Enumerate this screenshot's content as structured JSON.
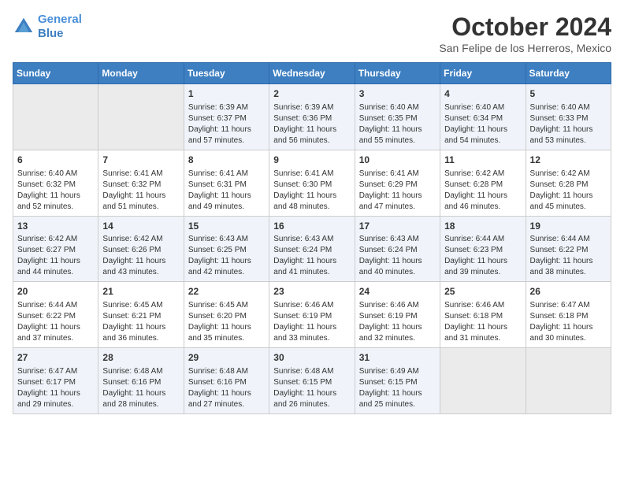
{
  "header": {
    "logo_line1": "General",
    "logo_line2": "Blue",
    "title": "October 2024",
    "subtitle": "San Felipe de los Herreros, Mexico"
  },
  "weekdays": [
    "Sunday",
    "Monday",
    "Tuesday",
    "Wednesday",
    "Thursday",
    "Friday",
    "Saturday"
  ],
  "weeks": [
    [
      {
        "day": "",
        "sunrise": "",
        "sunset": "",
        "daylight": ""
      },
      {
        "day": "",
        "sunrise": "",
        "sunset": "",
        "daylight": ""
      },
      {
        "day": "1",
        "sunrise": "Sunrise: 6:39 AM",
        "sunset": "Sunset: 6:37 PM",
        "daylight": "Daylight: 11 hours and 57 minutes."
      },
      {
        "day": "2",
        "sunrise": "Sunrise: 6:39 AM",
        "sunset": "Sunset: 6:36 PM",
        "daylight": "Daylight: 11 hours and 56 minutes."
      },
      {
        "day": "3",
        "sunrise": "Sunrise: 6:40 AM",
        "sunset": "Sunset: 6:35 PM",
        "daylight": "Daylight: 11 hours and 55 minutes."
      },
      {
        "day": "4",
        "sunrise": "Sunrise: 6:40 AM",
        "sunset": "Sunset: 6:34 PM",
        "daylight": "Daylight: 11 hours and 54 minutes."
      },
      {
        "day": "5",
        "sunrise": "Sunrise: 6:40 AM",
        "sunset": "Sunset: 6:33 PM",
        "daylight": "Daylight: 11 hours and 53 minutes."
      }
    ],
    [
      {
        "day": "6",
        "sunrise": "Sunrise: 6:40 AM",
        "sunset": "Sunset: 6:32 PM",
        "daylight": "Daylight: 11 hours and 52 minutes."
      },
      {
        "day": "7",
        "sunrise": "Sunrise: 6:41 AM",
        "sunset": "Sunset: 6:32 PM",
        "daylight": "Daylight: 11 hours and 51 minutes."
      },
      {
        "day": "8",
        "sunrise": "Sunrise: 6:41 AM",
        "sunset": "Sunset: 6:31 PM",
        "daylight": "Daylight: 11 hours and 49 minutes."
      },
      {
        "day": "9",
        "sunrise": "Sunrise: 6:41 AM",
        "sunset": "Sunset: 6:30 PM",
        "daylight": "Daylight: 11 hours and 48 minutes."
      },
      {
        "day": "10",
        "sunrise": "Sunrise: 6:41 AM",
        "sunset": "Sunset: 6:29 PM",
        "daylight": "Daylight: 11 hours and 47 minutes."
      },
      {
        "day": "11",
        "sunrise": "Sunrise: 6:42 AM",
        "sunset": "Sunset: 6:28 PM",
        "daylight": "Daylight: 11 hours and 46 minutes."
      },
      {
        "day": "12",
        "sunrise": "Sunrise: 6:42 AM",
        "sunset": "Sunset: 6:28 PM",
        "daylight": "Daylight: 11 hours and 45 minutes."
      }
    ],
    [
      {
        "day": "13",
        "sunrise": "Sunrise: 6:42 AM",
        "sunset": "Sunset: 6:27 PM",
        "daylight": "Daylight: 11 hours and 44 minutes."
      },
      {
        "day": "14",
        "sunrise": "Sunrise: 6:42 AM",
        "sunset": "Sunset: 6:26 PM",
        "daylight": "Daylight: 11 hours and 43 minutes."
      },
      {
        "day": "15",
        "sunrise": "Sunrise: 6:43 AM",
        "sunset": "Sunset: 6:25 PM",
        "daylight": "Daylight: 11 hours and 42 minutes."
      },
      {
        "day": "16",
        "sunrise": "Sunrise: 6:43 AM",
        "sunset": "Sunset: 6:24 PM",
        "daylight": "Daylight: 11 hours and 41 minutes."
      },
      {
        "day": "17",
        "sunrise": "Sunrise: 6:43 AM",
        "sunset": "Sunset: 6:24 PM",
        "daylight": "Daylight: 11 hours and 40 minutes."
      },
      {
        "day": "18",
        "sunrise": "Sunrise: 6:44 AM",
        "sunset": "Sunset: 6:23 PM",
        "daylight": "Daylight: 11 hours and 39 minutes."
      },
      {
        "day": "19",
        "sunrise": "Sunrise: 6:44 AM",
        "sunset": "Sunset: 6:22 PM",
        "daylight": "Daylight: 11 hours and 38 minutes."
      }
    ],
    [
      {
        "day": "20",
        "sunrise": "Sunrise: 6:44 AM",
        "sunset": "Sunset: 6:22 PM",
        "daylight": "Daylight: 11 hours and 37 minutes."
      },
      {
        "day": "21",
        "sunrise": "Sunrise: 6:45 AM",
        "sunset": "Sunset: 6:21 PM",
        "daylight": "Daylight: 11 hours and 36 minutes."
      },
      {
        "day": "22",
        "sunrise": "Sunrise: 6:45 AM",
        "sunset": "Sunset: 6:20 PM",
        "daylight": "Daylight: 11 hours and 35 minutes."
      },
      {
        "day": "23",
        "sunrise": "Sunrise: 6:46 AM",
        "sunset": "Sunset: 6:19 PM",
        "daylight": "Daylight: 11 hours and 33 minutes."
      },
      {
        "day": "24",
        "sunrise": "Sunrise: 6:46 AM",
        "sunset": "Sunset: 6:19 PM",
        "daylight": "Daylight: 11 hours and 32 minutes."
      },
      {
        "day": "25",
        "sunrise": "Sunrise: 6:46 AM",
        "sunset": "Sunset: 6:18 PM",
        "daylight": "Daylight: 11 hours and 31 minutes."
      },
      {
        "day": "26",
        "sunrise": "Sunrise: 6:47 AM",
        "sunset": "Sunset: 6:18 PM",
        "daylight": "Daylight: 11 hours and 30 minutes."
      }
    ],
    [
      {
        "day": "27",
        "sunrise": "Sunrise: 6:47 AM",
        "sunset": "Sunset: 6:17 PM",
        "daylight": "Daylight: 11 hours and 29 minutes."
      },
      {
        "day": "28",
        "sunrise": "Sunrise: 6:48 AM",
        "sunset": "Sunset: 6:16 PM",
        "daylight": "Daylight: 11 hours and 28 minutes."
      },
      {
        "day": "29",
        "sunrise": "Sunrise: 6:48 AM",
        "sunset": "Sunset: 6:16 PM",
        "daylight": "Daylight: 11 hours and 27 minutes."
      },
      {
        "day": "30",
        "sunrise": "Sunrise: 6:48 AM",
        "sunset": "Sunset: 6:15 PM",
        "daylight": "Daylight: 11 hours and 26 minutes."
      },
      {
        "day": "31",
        "sunrise": "Sunrise: 6:49 AM",
        "sunset": "Sunset: 6:15 PM",
        "daylight": "Daylight: 11 hours and 25 minutes."
      },
      {
        "day": "",
        "sunrise": "",
        "sunset": "",
        "daylight": ""
      },
      {
        "day": "",
        "sunrise": "",
        "sunset": "",
        "daylight": ""
      }
    ]
  ]
}
